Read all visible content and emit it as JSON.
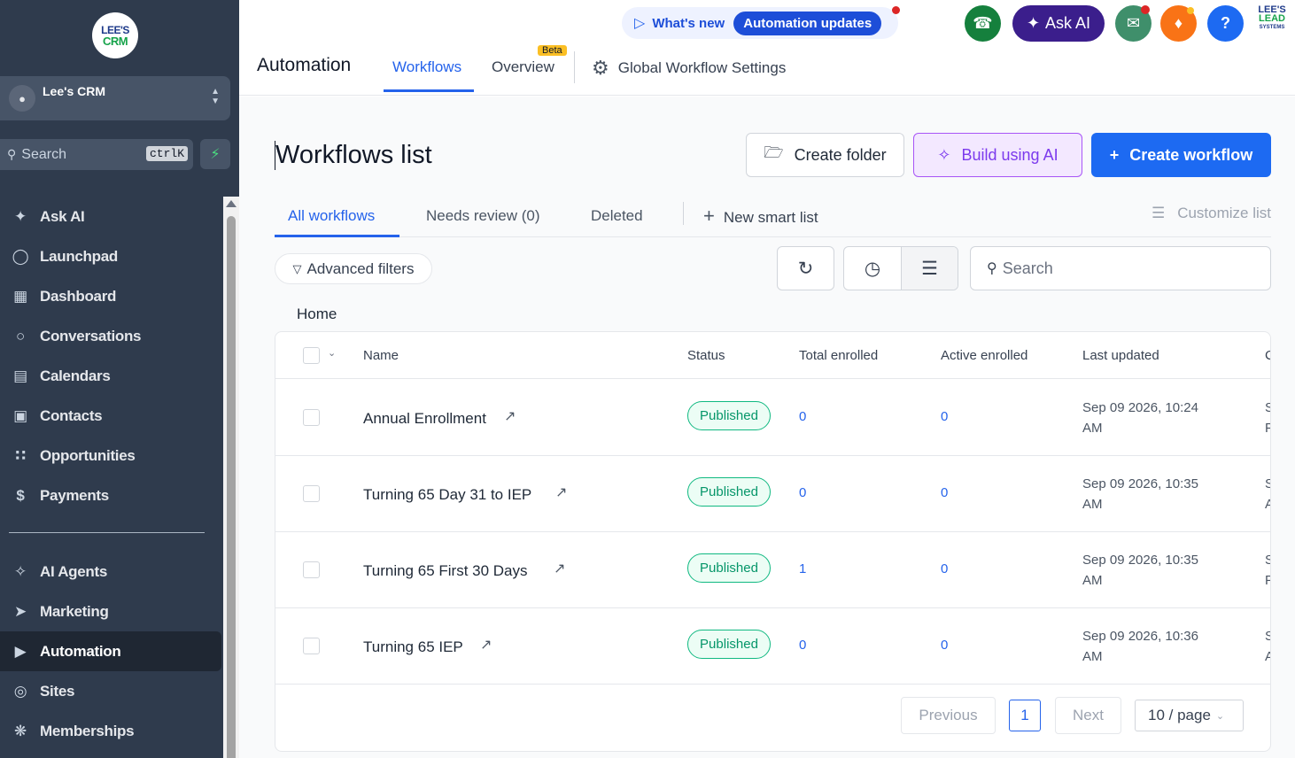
{
  "sidebar": {
    "logo_top": "LEE'S",
    "logo_bottom": "CRM",
    "account_name": "Lee's CRM",
    "search_placeholder": "Search",
    "search_shortcut": "ctrlK",
    "items": [
      {
        "label": "Ask AI",
        "icon": "sparkle-icon"
      },
      {
        "label": "Launchpad",
        "icon": "rocket-icon"
      },
      {
        "label": "Dashboard",
        "icon": "grid-icon"
      },
      {
        "label": "Conversations",
        "icon": "chat-icon"
      },
      {
        "label": "Calendars",
        "icon": "calendar-icon"
      },
      {
        "label": "Contacts",
        "icon": "contacts-icon"
      },
      {
        "label": "Opportunities",
        "icon": "pipeline-icon"
      },
      {
        "label": "Payments",
        "icon": "dollar-icon"
      }
    ],
    "items2": [
      {
        "label": "AI Agents",
        "icon": "sparkle-icon"
      },
      {
        "label": "Marketing",
        "icon": "send-icon"
      },
      {
        "label": "Automation",
        "icon": "play-icon",
        "active": true
      },
      {
        "label": "Sites",
        "icon": "globe-icon"
      },
      {
        "label": "Memberships",
        "icon": "badge-icon"
      }
    ]
  },
  "header": {
    "whats_new": "What's new",
    "automation_updates": "Automation updates",
    "ask_ai": "Ask AI",
    "help": "?",
    "logo_lines": [
      "LEE'S",
      "LEAD",
      "SYSTEMS"
    ],
    "page_title": "Automation",
    "tabs": [
      "Workflows",
      "Overview"
    ],
    "beta": "Beta",
    "global_settings": "Global Workflow Settings",
    "colors": {
      "phone": "#15803d",
      "ask_ai": "#3b1e8c",
      "announce": "#3f8f6b",
      "bell": "#f97316",
      "help": "#1d6af2"
    }
  },
  "main": {
    "title": "Workflows list",
    "create_folder": "Create folder",
    "build_ai": "Build using AI",
    "create_workflow": "Create workflow",
    "subtabs": [
      "All workflows",
      "Needs review (0)",
      "Deleted"
    ],
    "new_smart_list": "New smart list",
    "customize_list": "Customize list",
    "advanced_filters": "Advanced filters",
    "search_placeholder": "Search",
    "breadcrumb": "Home"
  },
  "table": {
    "headers": [
      "Name",
      "Status",
      "Total enrolled",
      "Active enrolled",
      "Last updated",
      "C"
    ],
    "rows": [
      {
        "name": "Annual Enrollment",
        "status": "Published",
        "total": "0",
        "active": "0",
        "updated_1": "Sep 09 2026, 10:24",
        "updated_2": "AM",
        "clip_1": "S",
        "clip_2": "F"
      },
      {
        "name": "Turning 65 Day 31 to IEP",
        "status": "Published",
        "total": "0",
        "active": "0",
        "updated_1": "Sep 09 2026, 10:35",
        "updated_2": "AM",
        "clip_1": "S",
        "clip_2": "A"
      },
      {
        "name": "Turning 65 First 30 Days",
        "status": "Published",
        "total": "1",
        "active": "0",
        "updated_1": "Sep 09 2026, 10:35",
        "updated_2": "AM",
        "clip_1": "S",
        "clip_2": "F"
      },
      {
        "name": "Turning 65 IEP",
        "status": "Published",
        "total": "0",
        "active": "0",
        "updated_1": "Sep 09 2026, 10:36",
        "updated_2": "AM",
        "clip_1": "S",
        "clip_2": "A"
      }
    ],
    "pager": {
      "previous": "Previous",
      "page": "1",
      "next": "Next",
      "page_size": "10 / page"
    }
  }
}
